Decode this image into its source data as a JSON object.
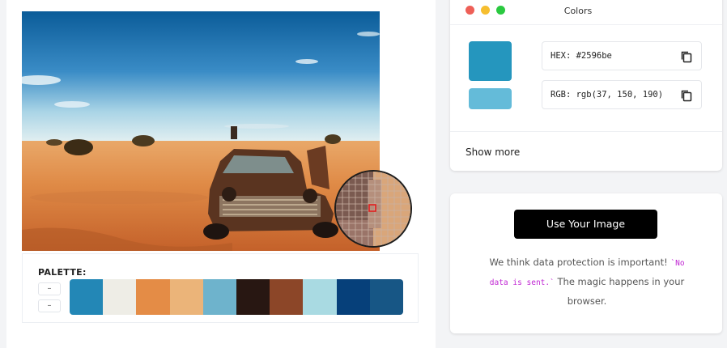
{
  "palette": {
    "label": "PALETTE:",
    "buttons": [
      "–",
      "–"
    ],
    "swatches": [
      "#2387b6",
      "#eeede6",
      "#e48c46",
      "#ebb479",
      "#6eb3cc",
      "#281712",
      "#8c4628",
      "#a9dae2",
      "#06407a",
      "#175685"
    ]
  },
  "colors_panel": {
    "title": "Colors",
    "window_buttons": [
      "#ee5f57",
      "#f6be2f",
      "#2ac940"
    ],
    "primary_color": "#2596be",
    "secondary_color": "#64bbd9",
    "hex_text": "HEX: #2596be",
    "rgb_text": "RGB: rgb(37, 150, 190)",
    "show_more": "Show more"
  },
  "upload": {
    "button_label": "Use Your Image",
    "info_before": "We think data protection is important!",
    "info_code": "`No data is sent.`",
    "info_after": "The magic happens in your browser."
  },
  "icons": {
    "copy": "copy-icon",
    "magnifier": "magnifier-loupe"
  }
}
